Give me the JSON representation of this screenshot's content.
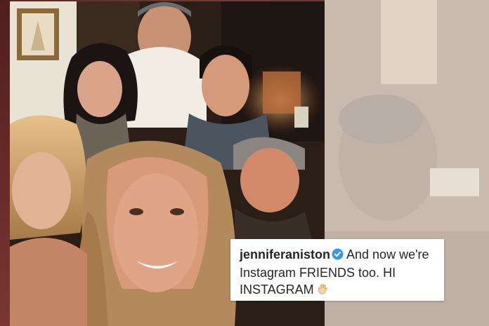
{
  "post": {
    "username": "jenniferaniston",
    "verified_icon": "verified-badge-icon",
    "caption_line1": "And now we're",
    "caption_line2": "Instagram FRIENDS too. HI",
    "caption_line3": "INSTAGRAM",
    "emoji_icon": "waving-hand-icon"
  },
  "colors": {
    "verified_blue": "#3897f0",
    "caption_text": "#262626",
    "frame_red": "#6b2e2c"
  }
}
